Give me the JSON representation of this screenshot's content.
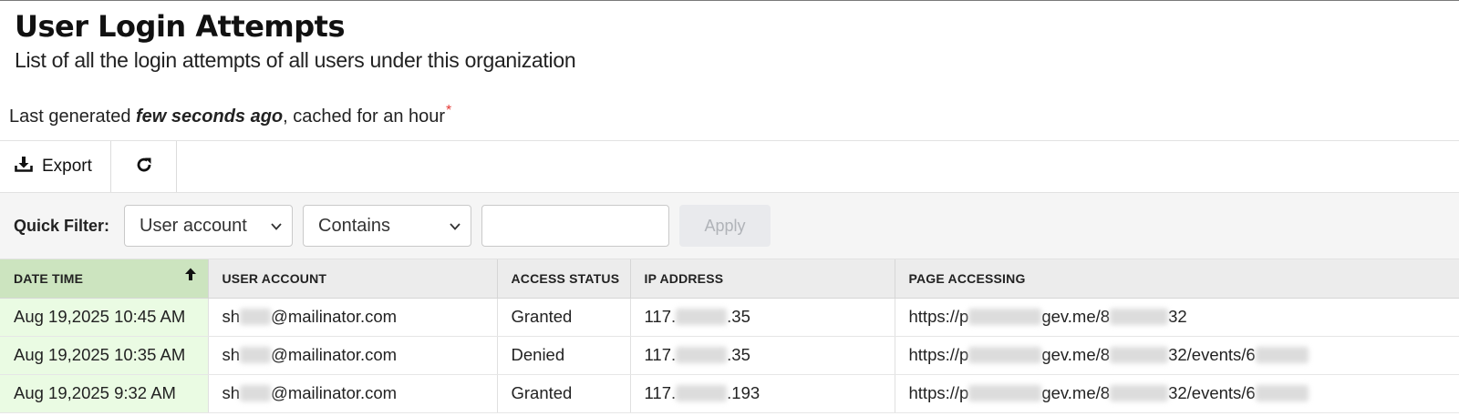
{
  "header": {
    "title": "User Login Attempts",
    "subtitle": "List of all the login attempts of all users under this organization"
  },
  "cache": {
    "prefix": "Last generated ",
    "age": "few seconds ago",
    "suffix": ", cached for an hour",
    "asterisk": "*"
  },
  "toolbar": {
    "export_label": "Export",
    "export_icon": "download-icon",
    "refresh_icon": "refresh-icon"
  },
  "filter": {
    "label": "Quick Filter:",
    "field_value": "User account",
    "operator_value": "Contains",
    "input_value": "",
    "apply_label": "Apply"
  },
  "table": {
    "columns": [
      "DATE TIME",
      "USER ACCOUNT",
      "ACCESS STATUS",
      "IP ADDRESS",
      "PAGE ACCESSING"
    ],
    "sorted_column": "DATE TIME",
    "sort_direction": "ascending",
    "rows": [
      {
        "date_time": "Aug 19,2025 10:45 AM",
        "user_pre": "sh",
        "user_post": "@mailinator.com",
        "status": "Granted",
        "ip_pre": "117.",
        "ip_post": ".35",
        "page_pre": "https://p",
        "page_mid": "gev.me/8",
        "page_post": "32",
        "page_tail": ""
      },
      {
        "date_time": "Aug 19,2025 10:35 AM",
        "user_pre": "sh",
        "user_post": "@mailinator.com",
        "status": "Denied",
        "ip_pre": "117.",
        "ip_post": ".35",
        "page_pre": "https://p",
        "page_mid": "gev.me/8",
        "page_post": "32/events/6",
        "page_tail": ""
      },
      {
        "date_time": "Aug 19,2025 9:32 AM",
        "user_pre": "sh",
        "user_post": "@mailinator.com",
        "status": "Granted",
        "ip_pre": "117.",
        "ip_post": ".193",
        "page_pre": "https://p",
        "page_mid": "gev.me/8",
        "page_post": "32/events/6",
        "page_tail": ""
      }
    ]
  },
  "colors": {
    "sorted_header": "#cce4bf",
    "date_cell": "#eafbe3",
    "asterisk": "#e53935"
  }
}
